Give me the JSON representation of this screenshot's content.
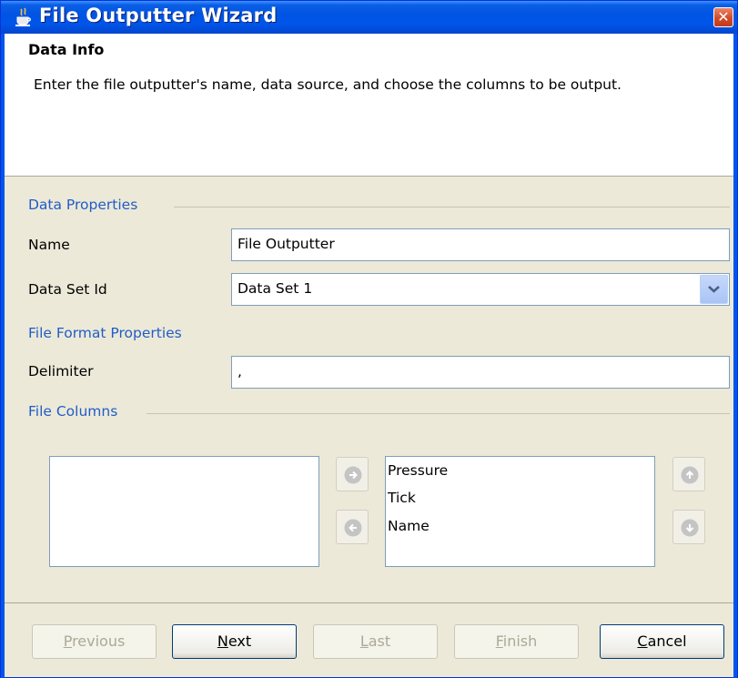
{
  "window": {
    "title": "File Outputter Wizard",
    "close_glyph": "✕",
    "title_icon": "java-cup-icon"
  },
  "header": {
    "title": "Data Info",
    "description": "Enter the file outputter's name, data source, and choose the columns to be output."
  },
  "data_properties": {
    "section_label": "Data Properties",
    "name_label": "Name",
    "name_value": "File Outputter",
    "dataset_label": "Data Set Id",
    "dataset_value": "Data Set 1"
  },
  "file_format": {
    "section_label": "File Format Properties",
    "delimiter_label": "Delimiter",
    "delimiter_value": ","
  },
  "file_columns": {
    "section_label": "File Columns",
    "available": [],
    "selected": [
      "Pressure",
      "Tick",
      "Name"
    ]
  },
  "buttons": {
    "previous": {
      "prefix": "",
      "mnemonic": "P",
      "rest": "revious"
    },
    "next": {
      "prefix": "",
      "mnemonic": "N",
      "rest": "ext"
    },
    "last": {
      "prefix": "",
      "mnemonic": "L",
      "rest": "ast"
    },
    "finish": {
      "prefix": "",
      "mnemonic": "F",
      "rest": "inish"
    },
    "cancel": {
      "prefix": "",
      "mnemonic": "C",
      "rest": "ancel"
    }
  },
  "colors": {
    "titlebar": "#0055ea",
    "section_text": "#215dc6",
    "dialog_bg": "#ece9d8"
  }
}
